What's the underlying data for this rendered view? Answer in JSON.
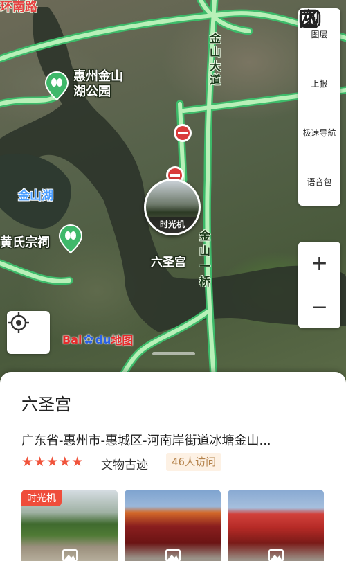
{
  "map": {
    "roads": {
      "huannan": "环南路",
      "jinshan_avenue": "金山大道",
      "jinshan_bridge": "金山一桥"
    },
    "pois": {
      "park": "惠州金山\n湖公园",
      "lake": "金山湖",
      "ancestral_hall": "黄氏宗祠",
      "temple": "六圣宫"
    },
    "time_machine_label": "时光机",
    "logo_text_left": "Bai",
    "logo_text_mid": "du",
    "logo_text_right": "地图",
    "toolbar": [
      {
        "label": "图层",
        "icon": "layers-icon"
      },
      {
        "label": "上报",
        "icon": "report-edit-icon"
      },
      {
        "label": "极速导航",
        "icon": "navigation-arrow-icon"
      },
      {
        "label": "语音包",
        "icon": "voice-pack-icon"
      }
    ],
    "zoom_in": "+",
    "zoom_out": "−"
  },
  "place": {
    "name": "六圣宫",
    "address": "广东省-惠州市-惠城区-河南岸街道冰塘金山...",
    "rating": 5,
    "category": "文物古迹",
    "visits": "46人访问",
    "photos": [
      {
        "tag": "时光机",
        "icon": "image-icon"
      },
      {
        "tag": "",
        "icon": "image-icon"
      },
      {
        "tag": "",
        "icon": "image-icon"
      }
    ]
  },
  "colors": {
    "road": "#b8f0b8",
    "road_edge": "#3dbb6a",
    "poi_green": "#3fb86a",
    "accent_red": "#ef4d3b",
    "star": "#f0543c",
    "lake_label": "#4a9eff"
  }
}
